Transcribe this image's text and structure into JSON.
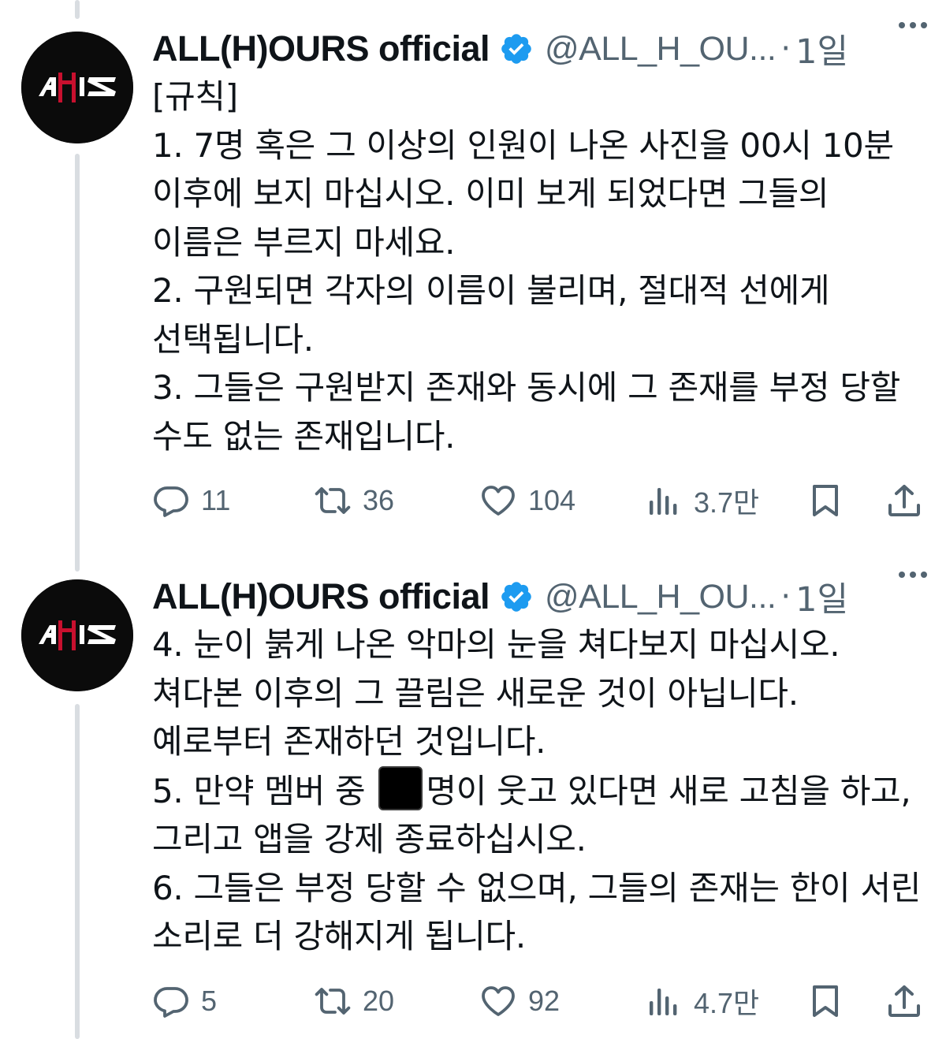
{
  "tweets": [
    {
      "author": {
        "display_name": "ALL(H)OURS official",
        "handle": "@ALL_H_OU...",
        "verified": true,
        "avatar": "allhours-logo"
      },
      "separator": "·",
      "time": "1일",
      "more_icon": "more-horizontal-icon",
      "text": "[규칙]\n1. 7명 혹은 그 이상의 인원이 나온 사진을 00시 10분 이후에 보지 마십시오. 이미 보게 되었다면 그들의 이름은 부르지 마세요.\n2. 구원되면 각자의 이름이 불리며, 절대적 선에게 선택됩니다.\n3. 그들은 구원받지 존재와 동시에 그 존재를 부정 당할 수도 없는 존재입니다.",
      "stats": {
        "replies": "11",
        "retweets": "36",
        "likes": "104",
        "views": "3.7만"
      }
    },
    {
      "author": {
        "display_name": "ALL(H)OURS official",
        "handle": "@ALL_H_OU...",
        "verified": true,
        "avatar": "allhours-logo"
      },
      "separator": "·",
      "time": "1일",
      "more_icon": "more-horizontal-icon",
      "text_before_emoji": "4. 눈이 붉게 나온 악마의 눈을 쳐다보지 마십시오. 쳐다본 이후의 그 끌림은 새로운 것이 아닙니다. 예로부터 존재하던 것입니다.\n5. 만약 멤버 중 ",
      "emoji": "black-large-square",
      "text_after_emoji": "명이 웃고 있다면 새로 고침을 하고, 그리고 앱을 강제 종료하십시오.\n6. 그들은 부정 당할 수 없으며, 그들의 존재는 한이 서린 소리로 더 강해지게 됩니다.",
      "stats": {
        "replies": "5",
        "retweets": "20",
        "likes": "92",
        "views": "4.7만"
      }
    }
  ],
  "colors": {
    "text": "#0f1419",
    "secondary": "#536471",
    "verified": "#1d9bf0",
    "thread_line": "#d9dde1",
    "logo_red": "#c8102e"
  }
}
